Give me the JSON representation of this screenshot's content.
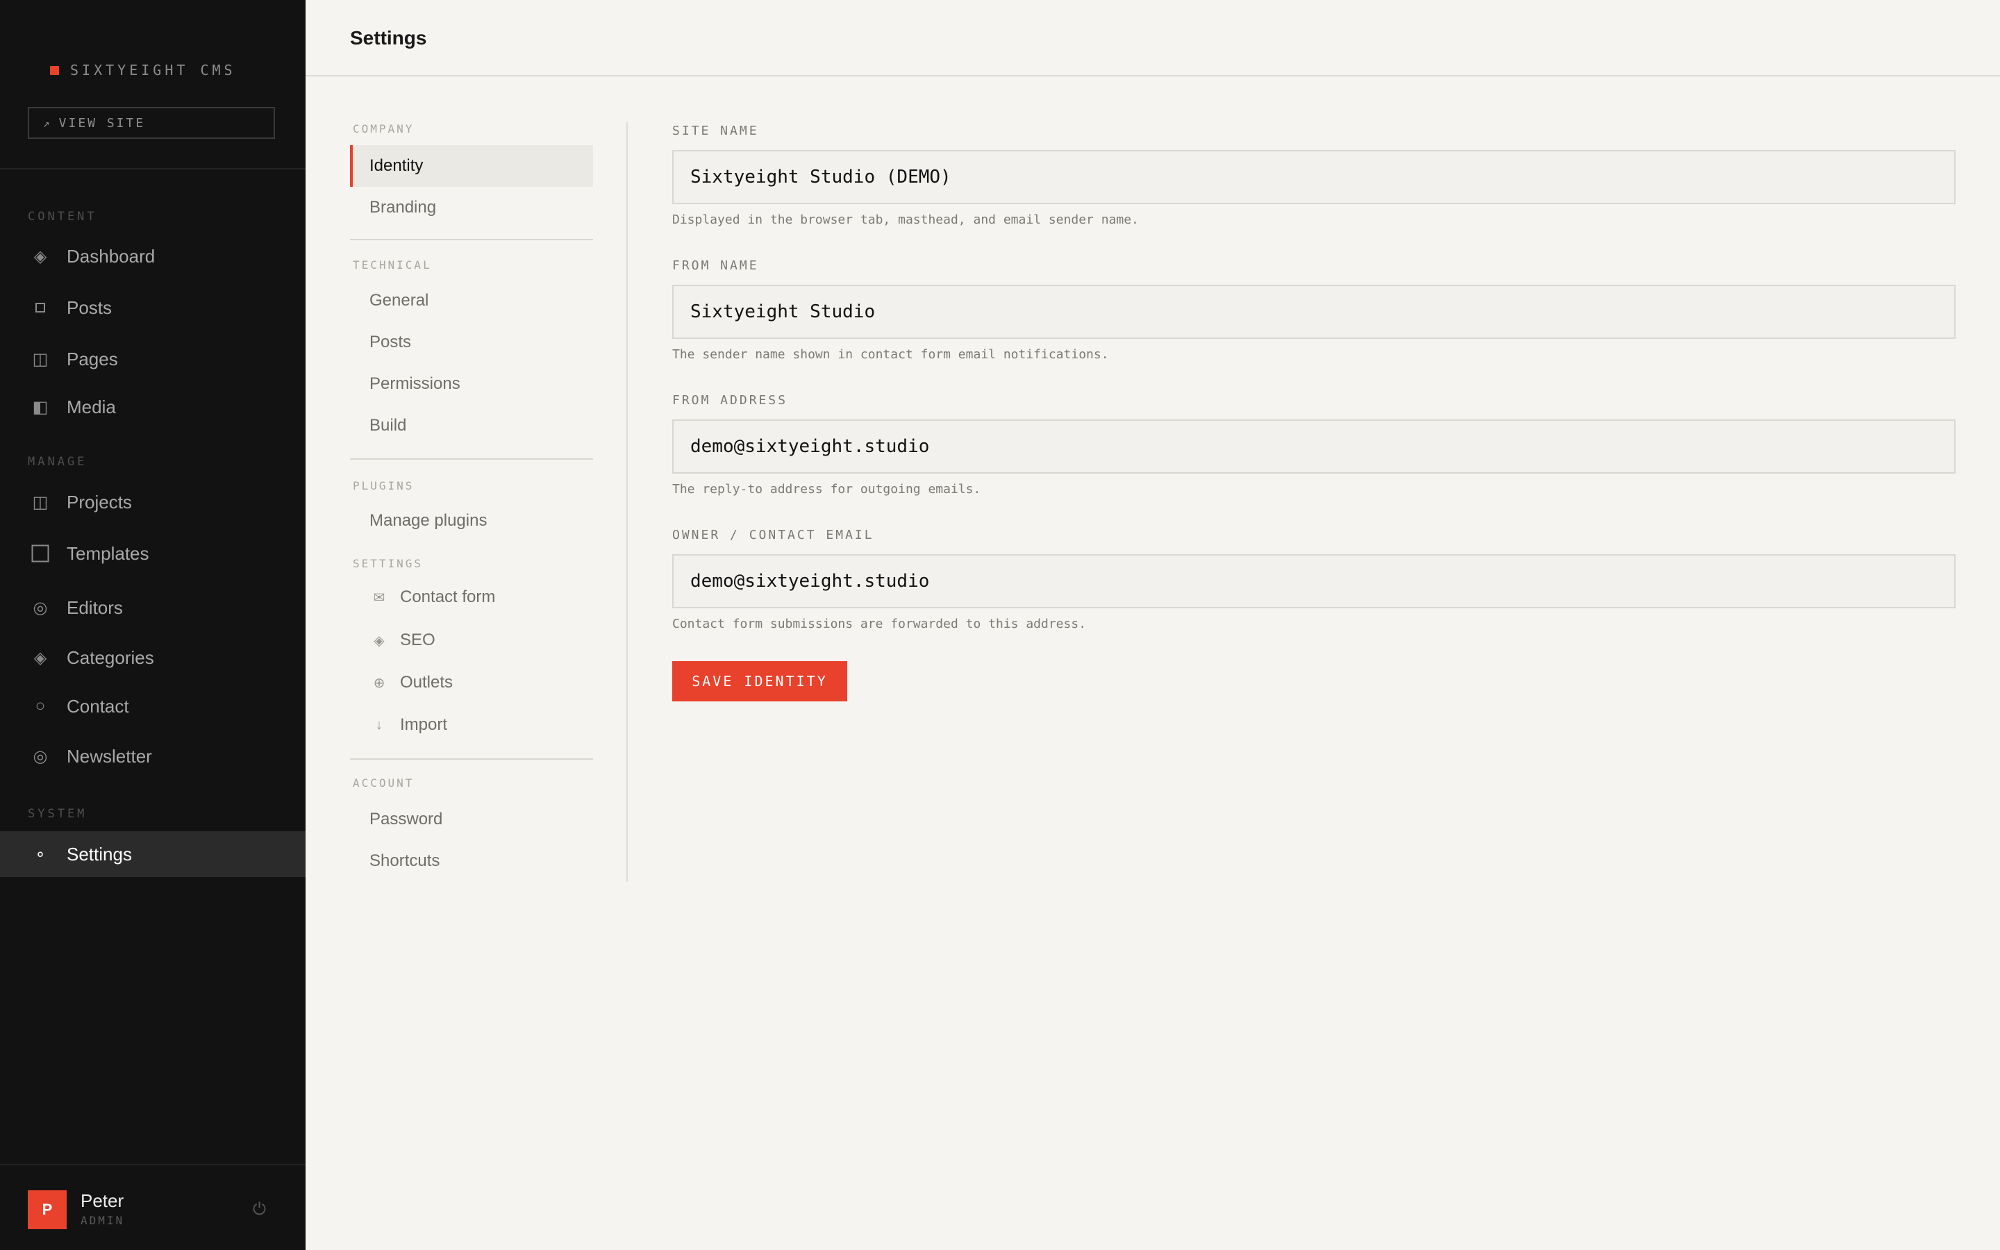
{
  "app": {
    "brand_name": "SIXTYEIGHT CMS",
    "view_site_label": "VIEW SITE",
    "accent_color": "#e8412c"
  },
  "sidebar": {
    "sections": {
      "content": "CONTENT",
      "manage": "MANAGE",
      "system": "SYSTEM"
    },
    "items": [
      {
        "label": "Dashboard",
        "icon": "diamond-icon"
      },
      {
        "label": "Posts",
        "icon": "square-icon"
      },
      {
        "label": "Pages",
        "icon": "columns-icon"
      },
      {
        "label": "Media",
        "icon": "half-square-icon"
      },
      {
        "label": "Projects",
        "icon": "columns-icon"
      },
      {
        "label": "Templates",
        "icon": "square-outline-icon"
      },
      {
        "label": "Editors",
        "icon": "target-icon"
      },
      {
        "label": "Categories",
        "icon": "diamond-icon"
      },
      {
        "label": "Contact",
        "icon": "circle-icon"
      },
      {
        "label": "Newsletter",
        "icon": "target-icon"
      },
      {
        "label": "Settings",
        "icon": "dot-icon",
        "active": true
      }
    ],
    "user": {
      "initial": "P",
      "name": "Peter",
      "role": "ADMIN"
    }
  },
  "header": {
    "title": "Settings"
  },
  "subnav": {
    "sections": {
      "company": "COMPANY",
      "technical": "TECHNICAL",
      "plugins": "PLUGINS",
      "settings": "SETTINGS",
      "account": "ACCOUNT"
    },
    "items": {
      "identity": "Identity",
      "branding": "Branding",
      "general": "General",
      "posts": "Posts",
      "permissions": "Permissions",
      "build": "Build",
      "manage_plugins": "Manage plugins",
      "contact_form": "Contact form",
      "seo": "SEO",
      "outlets": "Outlets",
      "import": "Import",
      "password": "Password",
      "shortcuts": "Shortcuts"
    }
  },
  "form": {
    "site_name": {
      "label": "SITE NAME",
      "value": "Sixtyeight Studio (DEMO)",
      "help": "Displayed in the browser tab, masthead, and email sender name."
    },
    "from_name": {
      "label": "FROM NAME",
      "value": "Sixtyeight Studio",
      "help": "The sender name shown in contact form email notifications."
    },
    "from_address": {
      "label": "FROM ADDRESS",
      "value": "demo@sixtyeight.studio",
      "help": "The reply-to address for outgoing emails."
    },
    "owner_email": {
      "label": "OWNER / CONTACT EMAIL",
      "value": "demo@sixtyeight.studio",
      "help": "Contact form submissions are forwarded to this address."
    },
    "save_label": "SAVE IDENTITY"
  }
}
